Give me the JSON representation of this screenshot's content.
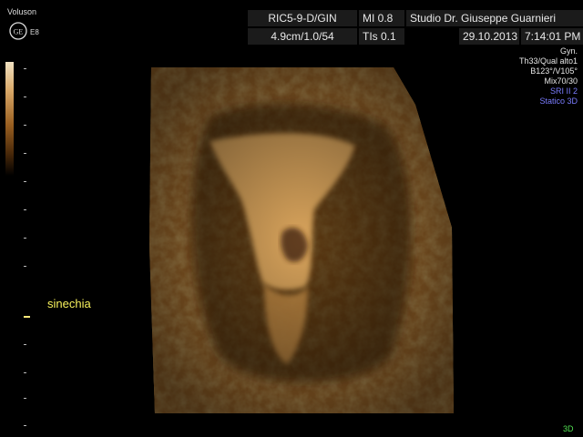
{
  "header": {
    "brand": "Voluson",
    "model": "E8",
    "probe": "RIC5-9-D/GIN",
    "mi": "MI  0.8",
    "clinic": "Studio Dr. Giuseppe Guarnieri",
    "depth": "4.9cm/1.0/54",
    "tis": "TIs  0.1",
    "date": "29.10.2013",
    "time": "7:14:01 PM"
  },
  "params": {
    "mode": "Gyn.",
    "quality": "Th33/Qual alto1",
    "angles": "B123°/V105°",
    "mix": "Mix70/30",
    "sri": "SRI II 2",
    "static": "Statico 3D"
  },
  "annotation": "sinechia",
  "badge": "3D",
  "colors": {
    "annotation": "#f7f15c",
    "blue_text": "#7a7cff",
    "badge": "#52e052",
    "tissue": "#b5792f"
  },
  "icons": {
    "logo": "ge-logo-icon"
  }
}
